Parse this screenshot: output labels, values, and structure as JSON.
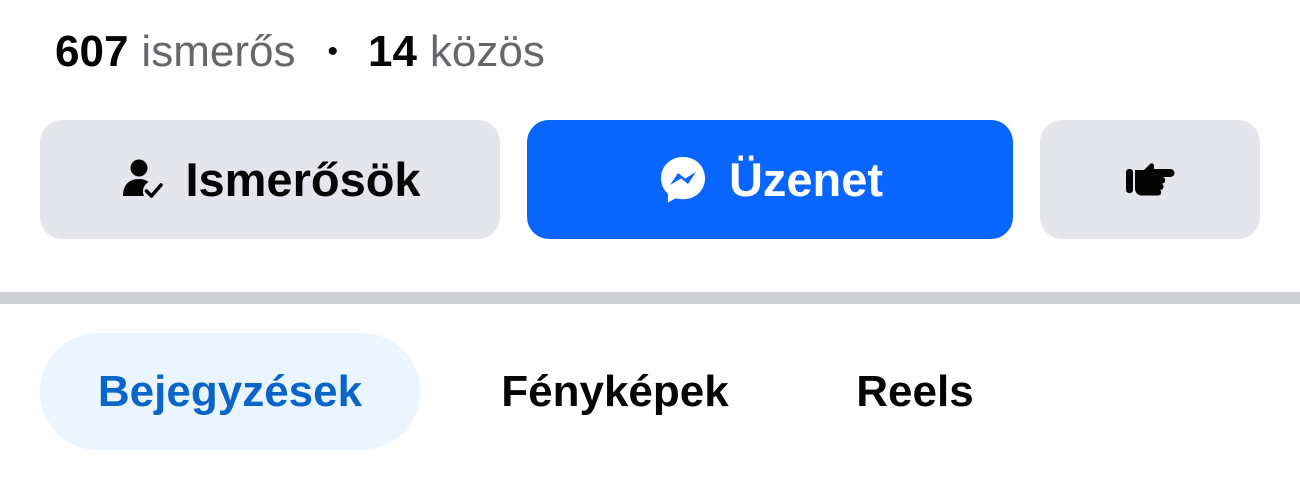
{
  "stats": {
    "friends_count": "607",
    "friends_label": "ismerős",
    "separator": "•",
    "mutual_count": "14",
    "mutual_label": "közös"
  },
  "actions": {
    "friends_button_label": "Ismerősök",
    "friends_icon": "person-check-icon",
    "message_button_label": "Üzenet",
    "message_icon": "messenger-icon",
    "more_icon": "pointing-hand-icon"
  },
  "tabs": [
    {
      "label": "Bejegyzések",
      "selected": true
    },
    {
      "label": "Fényképek",
      "selected": false
    },
    {
      "label": "Reels",
      "selected": false
    }
  ],
  "colors": {
    "primary_button": "#0866ff",
    "secondary_button": "#e4e6eb",
    "selected_tab_bg": "#ebf5ff",
    "selected_tab_text": "#0a65c9",
    "divider": "#ced0d4"
  }
}
